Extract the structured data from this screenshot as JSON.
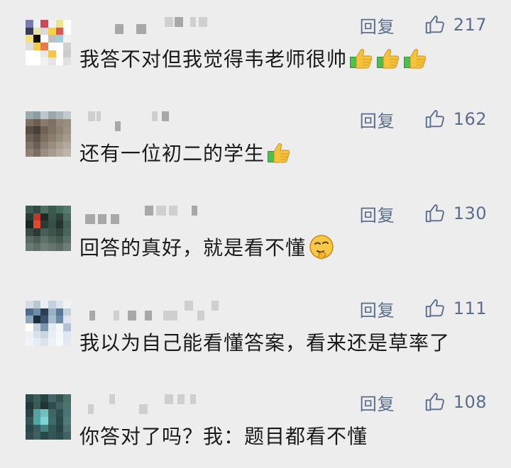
{
  "reply_label": "回复",
  "colors": {
    "action": "#5a6d8c",
    "text": "#1a1a1a",
    "background": "#ededed"
  },
  "comments": [
    {
      "text": "我答不对但我觉得韦老师很帅",
      "likes": "217",
      "emoji": [
        "thumbs-up-icon",
        "thumbs-up-icon",
        "thumbs-up-icon"
      ]
    },
    {
      "text": "还有一位初二的学生",
      "likes": "162",
      "emoji": [
        "thumbs-up-icon"
      ]
    },
    {
      "text": "回答的真好，就是看不懂",
      "likes": "130",
      "emoji": [
        "thinking-face-icon"
      ]
    },
    {
      "text": "我以为自己能看懂答案，看来还是草率了",
      "likes": "111",
      "emoji": []
    },
    {
      "text": "你答对了吗？我：题目都看不懂",
      "likes": "108",
      "emoji": []
    }
  ]
}
